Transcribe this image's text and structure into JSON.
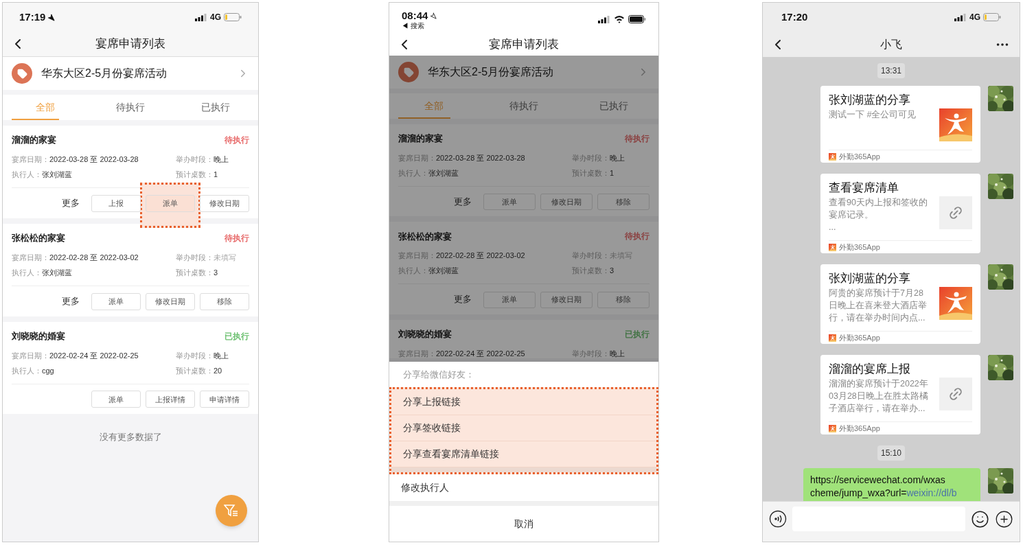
{
  "list_screen": {
    "status_bar": {
      "time": "17:19",
      "network": "4G"
    },
    "title": "宴席申请列表",
    "activity": "华东大区2-5月份宴席活动",
    "tabs": [
      {
        "label": "全部",
        "selected": true
      },
      {
        "label": "待执行",
        "selected": false
      },
      {
        "label": "已执行",
        "selected": false
      }
    ],
    "cards": [
      {
        "title": "溜溜的家宴",
        "status": "待执行",
        "color": "#e86c6c",
        "fields": [
          {
            "label": "宴席日期：",
            "value": "2022-03-28 至 2022-03-28",
            "muted": false
          },
          {
            "label": "举办时段：",
            "value": "晚上",
            "muted": false
          },
          {
            "label": "执行人：",
            "value": "张刘湖蓝",
            "muted": false
          },
          {
            "label": "预计桌数：",
            "value": "1",
            "muted": false
          }
        ],
        "actions": [
          {
            "kind": "text",
            "label": "更多",
            "highlighted": false
          },
          {
            "kind": "button",
            "label": "上报",
            "highlighted": false
          },
          {
            "kind": "button",
            "label": "派单",
            "highlighted": true
          },
          {
            "kind": "button",
            "label": "修改日期",
            "highlighted": false
          }
        ]
      },
      {
        "title": "张松松的家宴",
        "status": "待执行",
        "color": "#e86c6c",
        "fields": [
          {
            "label": "宴席日期：",
            "value": "2022-02-28 至 2022-03-02",
            "muted": false
          },
          {
            "label": "举办时段：",
            "value": "未填写",
            "muted": true
          },
          {
            "label": "执行人：",
            "value": "张刘湖蓝",
            "muted": false
          },
          {
            "label": "预计桌数：",
            "value": "3",
            "muted": false
          }
        ],
        "actions": [
          {
            "kind": "text",
            "label": "更多",
            "highlighted": false
          },
          {
            "kind": "button",
            "label": "派单",
            "highlighted": false
          },
          {
            "kind": "button",
            "label": "修改日期",
            "highlighted": false
          },
          {
            "kind": "button",
            "label": "移除",
            "highlighted": false
          }
        ]
      },
      {
        "title": "刘晓晓的婚宴",
        "status": "已执行",
        "color": "#6cc070",
        "fields": [
          {
            "label": "宴席日期：",
            "value": "2022-02-24 至 2022-02-25",
            "muted": false
          },
          {
            "label": "举办时段：",
            "value": "晚上",
            "muted": false
          },
          {
            "label": "执行人：",
            "value": "cgg",
            "muted": false
          },
          {
            "label": "预计桌数：",
            "value": "20",
            "muted": false
          }
        ],
        "actions": [
          {
            "kind": "button",
            "label": "派单",
            "highlighted": false
          },
          {
            "kind": "button",
            "label": "上报详情",
            "highlighted": false
          },
          {
            "kind": "button",
            "label": "申请详情",
            "highlighted": false
          }
        ]
      }
    ],
    "footer_note": "没有更多数据了"
  },
  "share_screen": {
    "status_bar": {
      "time": "08:44",
      "back_link": "◀ 搜索"
    },
    "title": "宴席申请列表",
    "activity": "华东大区2-5月份宴席活动",
    "tabs": [
      {
        "label": "全部",
        "selected": true
      },
      {
        "label": "待执行",
        "selected": false
      },
      {
        "label": "已执行",
        "selected": false
      }
    ],
    "cards": [
      {
        "title": "溜溜的家宴",
        "status": "待执行",
        "color": "#8b4141",
        "fields": [
          {
            "label": "宴席日期：",
            "value": "2022-03-28 至 2022-03-28",
            "muted": false
          },
          {
            "label": "举办时段：",
            "value": "晚上",
            "muted": false
          },
          {
            "label": "执行人：",
            "value": "张刘湖蓝",
            "muted": false
          },
          {
            "label": "预计桌数：",
            "value": "1",
            "muted": false
          }
        ],
        "actions": [
          {
            "kind": "text",
            "label": "更多",
            "highlighted": false
          },
          {
            "kind": "button",
            "label": "派单",
            "highlighted": false
          },
          {
            "kind": "button",
            "label": "修改日期",
            "highlighted": false
          },
          {
            "kind": "button",
            "label": "移除",
            "highlighted": false
          }
        ]
      },
      {
        "title": "张松松的家宴",
        "status": "待执行",
        "color": "#8b4141",
        "fields": [
          {
            "label": "宴席日期：",
            "value": "2022-02-28 至 2022-03-02",
            "muted": false
          },
          {
            "label": "举办时段：",
            "value": "未填写",
            "muted": true
          },
          {
            "label": "执行人：",
            "value": "张刘湖蓝",
            "muted": false
          },
          {
            "label": "预计桌数：",
            "value": "3",
            "muted": false
          }
        ],
        "actions": [
          {
            "kind": "text",
            "label": "更多",
            "highlighted": false
          },
          {
            "kind": "button",
            "label": "派单",
            "highlighted": false
          },
          {
            "kind": "button",
            "label": "修改日期",
            "highlighted": false
          },
          {
            "kind": "button",
            "label": "移除",
            "highlighted": false
          }
        ]
      },
      {
        "title": "刘晓晓的婚宴",
        "status": "已执行",
        "color": "#417343",
        "fields": [
          {
            "label": "宴席日期：",
            "value": "2022-02-24 至 2022-02-25",
            "muted": false
          },
          {
            "label": "举办时段：",
            "value": "晚上",
            "muted": false
          }
        ]
      }
    ],
    "sheet": {
      "header": "分享给微信好友：",
      "groups": [
        {
          "highlighted": true,
          "options": [
            "分享上报链接",
            "分享签收链接",
            "分享查看宴席清单链接"
          ]
        },
        {
          "highlighted": false,
          "options": [
            "修改执行人"
          ]
        }
      ],
      "cancel": "取消"
    }
  },
  "chat_screen": {
    "status_bar": {
      "time": "17:20",
      "network": "4G"
    },
    "title": "小飞",
    "messages": [
      {
        "kind": "time",
        "text": "13:31"
      },
      {
        "kind": "card",
        "title": "张刘湖蓝的分享",
        "lines": [
          "测试一下 #全公司可见"
        ],
        "thumb": {
          "kind": "logo"
        },
        "source": "外勤365App"
      },
      {
        "kind": "card",
        "title": "查看宴席清单",
        "lines": [
          "查看90天内上报和签收的",
          "宴席记录。",
          "..."
        ],
        "thumb": {
          "kind": "link"
        },
        "source": "外勤365App"
      },
      {
        "kind": "card",
        "title": "张刘湖蓝的分享",
        "lines": [
          "阿贵的宴席预计于7月28",
          "日晚上在喜来登大酒店举",
          "行，请在举办时间内点..."
        ],
        "thumb": {
          "kind": "logo"
        },
        "source": "外勤365App"
      },
      {
        "kind": "card",
        "title": "溜溜的宴席上报",
        "lines": [
          "溜溜的宴席预计于2022年",
          "03月28日晚上在胜太路橘",
          "子酒店举行，请在举办..."
        ],
        "thumb": {
          "kind": "link"
        },
        "source": "外勤365App"
      },
      {
        "kind": "time",
        "text": "15:10"
      },
      {
        "kind": "text",
        "lines": [
          {
            "text": "https://servicewechat.com/wxas"
          },
          {
            "text": "cheme/jump_wxa?url=",
            "link": "weixin://dl/b"
          }
        ]
      }
    ]
  }
}
